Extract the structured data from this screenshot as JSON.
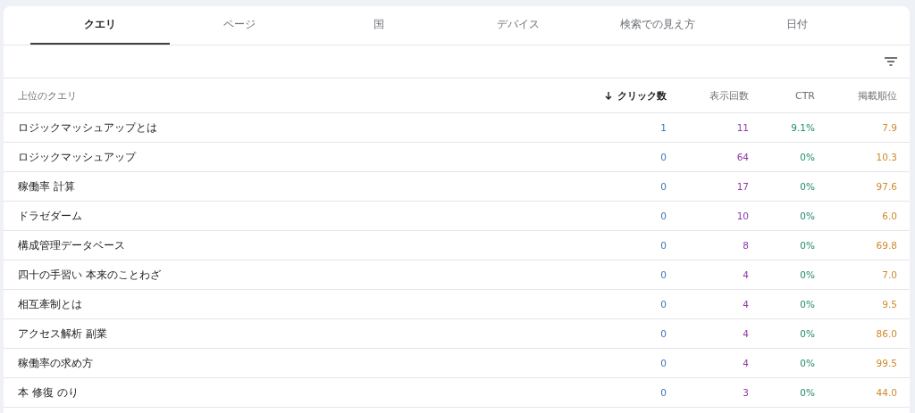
{
  "tabs": [
    {
      "label": "クエリ",
      "selected": true
    },
    {
      "label": "ページ",
      "selected": false
    },
    {
      "label": "国",
      "selected": false
    },
    {
      "label": "デバイス",
      "selected": false
    },
    {
      "label": "検索での見え方",
      "selected": false
    },
    {
      "label": "日付",
      "selected": false
    }
  ],
  "table": {
    "columns": [
      {
        "label": "上位のクエリ",
        "sorted": false
      },
      {
        "label": "クリック数",
        "sorted": true
      },
      {
        "label": "表示回数",
        "sorted": false
      },
      {
        "label": "CTR",
        "sorted": false
      },
      {
        "label": "掲載順位",
        "sorted": false
      }
    ],
    "rows": [
      [
        "ロジックマッシュアップとは",
        "1",
        "11",
        "9.1%",
        "7.9"
      ],
      [
        "ロジックマッシュアップ",
        "0",
        "64",
        "0%",
        "10.3"
      ],
      [
        "稼働率 計算",
        "0",
        "17",
        "0%",
        "97.6"
      ],
      [
        "ドラゼダーム",
        "0",
        "10",
        "0%",
        "6.0"
      ],
      [
        "構成管理データベース",
        "0",
        "8",
        "0%",
        "69.8"
      ],
      [
        "四十の手習い 本来のことわざ",
        "0",
        "4",
        "0%",
        "7.0"
      ],
      [
        "相互牽制とは",
        "0",
        "4",
        "0%",
        "9.5"
      ],
      [
        "アクセス解析 副業",
        "0",
        "4",
        "0%",
        "86.0"
      ],
      [
        "稼働率の求め方",
        "0",
        "4",
        "0%",
        "99.5"
      ],
      [
        "本 修復 のり",
        "0",
        "3",
        "0%",
        "44.0"
      ]
    ]
  }
}
